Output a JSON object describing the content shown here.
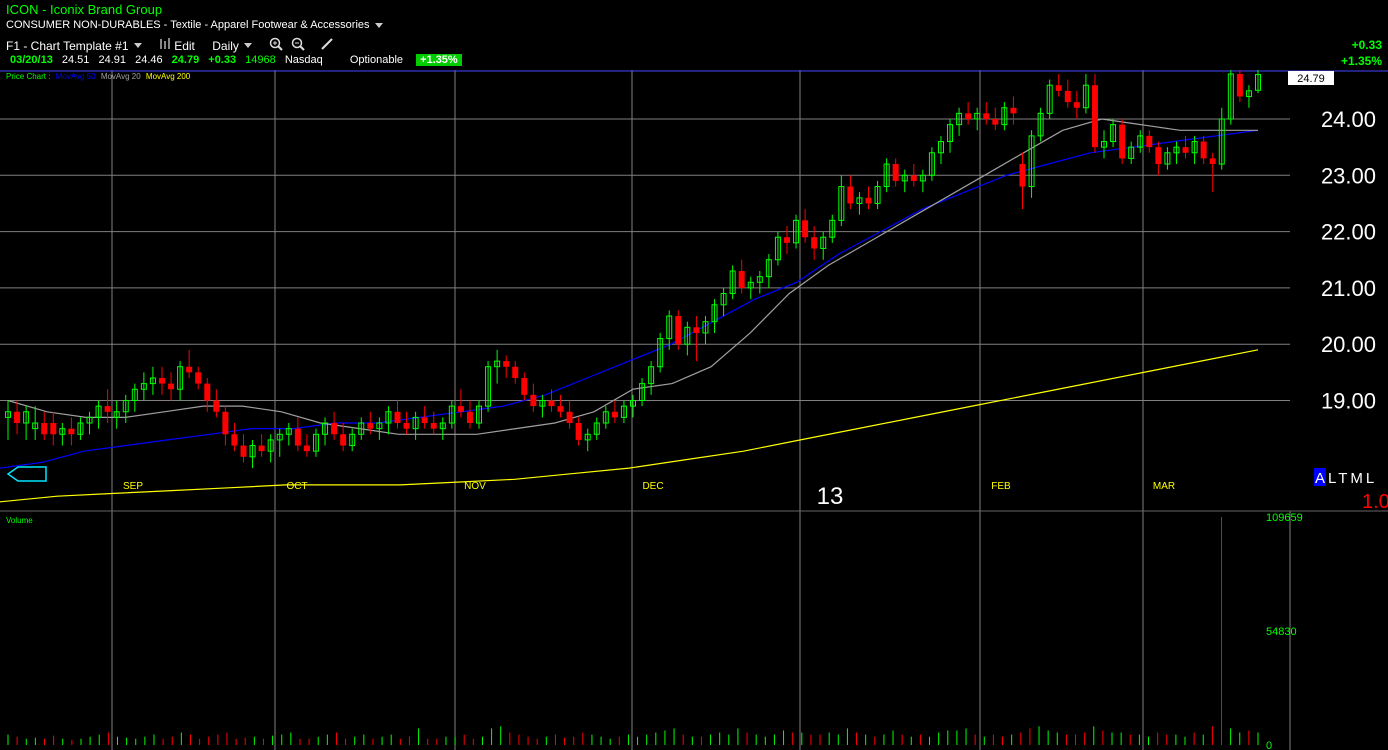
{
  "header": {
    "title": "ICON  -  Iconix Brand Group",
    "sector": "CONSUMER NON-DURABLES - Textile - Apparel Footwear & Accessories",
    "template": "F1 - Chart Template #1",
    "edit_label": "Edit",
    "period": "Daily"
  },
  "quote": {
    "date": "03/20/13",
    "open": "24.51",
    "high": "24.91",
    "low": "24.46",
    "last": "24.79",
    "change": "+0.33",
    "volume": "14968",
    "exchange": "Nasdaq",
    "optionable": "Optionable",
    "pct_change": "+1.35%"
  },
  "right_change": {
    "abs": "+0.33",
    "pct": "+1.35%"
  },
  "price_pane": {
    "legend": {
      "label": "Price Chart :",
      "ma50": "MovAvg 50",
      "ma20": "MovAvg 20",
      "ma200": "MovAvg 200"
    },
    "last_price_tag": "24.79",
    "y_ticks": [
      "24.00",
      "23.00",
      "22.00",
      "21.00",
      "20.00",
      "19.00"
    ],
    "months": [
      "SEP",
      "OCT",
      "NOV",
      "DEC",
      "FEB",
      "MAR"
    ],
    "year_marker": "13",
    "altml": {
      "a": "A",
      "rest": "LTML",
      "value": "1.0"
    }
  },
  "volume_pane": {
    "label": "Volume",
    "ticks": [
      "109659",
      "54830",
      "0"
    ]
  },
  "colors": {
    "up": "#00ff00",
    "down": "#ff0000",
    "ma50": "#0000ff",
    "ma20": "#a0a0a0",
    "ma200": "#ffff00",
    "grid": "#808080"
  },
  "chart_data": {
    "type": "candlestick",
    "symbol": "ICON",
    "x_period": "Daily",
    "y_ticks": [
      19,
      20,
      21,
      22,
      23,
      24
    ],
    "ohlc": [
      [
        18.7,
        19.0,
        18.3,
        18.8
      ],
      [
        18.8,
        19.0,
        18.4,
        18.6
      ],
      [
        18.6,
        18.9,
        18.3,
        18.8
      ],
      [
        18.5,
        18.9,
        18.3,
        18.6
      ],
      [
        18.6,
        18.8,
        18.3,
        18.4
      ],
      [
        18.6,
        18.8,
        18.2,
        18.4
      ],
      [
        18.4,
        18.6,
        18.2,
        18.5
      ],
      [
        18.5,
        18.7,
        18.2,
        18.4
      ],
      [
        18.4,
        18.7,
        18.3,
        18.6
      ],
      [
        18.6,
        18.8,
        18.4,
        18.7
      ],
      [
        18.7,
        19.0,
        18.5,
        18.9
      ],
      [
        18.9,
        19.2,
        18.6,
        18.8
      ],
      [
        18.7,
        19.0,
        18.5,
        18.8
      ],
      [
        18.8,
        19.1,
        18.6,
        19.0
      ],
      [
        19.0,
        19.3,
        18.8,
        19.2
      ],
      [
        19.2,
        19.5,
        19.0,
        19.3
      ],
      [
        19.3,
        19.6,
        19.1,
        19.4
      ],
      [
        19.4,
        19.6,
        19.1,
        19.3
      ],
      [
        19.3,
        19.5,
        19.0,
        19.2
      ],
      [
        19.2,
        19.7,
        19.0,
        19.6
      ],
      [
        19.6,
        19.9,
        19.4,
        19.5
      ],
      [
        19.5,
        19.6,
        19.2,
        19.3
      ],
      [
        19.3,
        19.4,
        18.8,
        19.0
      ],
      [
        19.0,
        19.2,
        18.7,
        18.8
      ],
      [
        18.8,
        18.9,
        18.2,
        18.4
      ],
      [
        18.4,
        18.6,
        18.1,
        18.2
      ],
      [
        18.2,
        18.4,
        17.9,
        18.0
      ],
      [
        18.0,
        18.3,
        17.8,
        18.2
      ],
      [
        18.2,
        18.4,
        18.0,
        18.1
      ],
      [
        18.1,
        18.4,
        17.9,
        18.3
      ],
      [
        18.3,
        18.5,
        18.0,
        18.4
      ],
      [
        18.4,
        18.6,
        18.2,
        18.5
      ],
      [
        18.5,
        18.7,
        18.1,
        18.2
      ],
      [
        18.2,
        18.4,
        18.0,
        18.1
      ],
      [
        18.1,
        18.5,
        18.0,
        18.4
      ],
      [
        18.4,
        18.7,
        18.2,
        18.6
      ],
      [
        18.6,
        18.8,
        18.3,
        18.4
      ],
      [
        18.4,
        18.6,
        18.1,
        18.2
      ],
      [
        18.2,
        18.5,
        18.1,
        18.4
      ],
      [
        18.4,
        18.7,
        18.3,
        18.6
      ],
      [
        18.6,
        18.8,
        18.4,
        18.5
      ],
      [
        18.5,
        18.7,
        18.3,
        18.6
      ],
      [
        18.6,
        18.9,
        18.4,
        18.8
      ],
      [
        18.8,
        19.0,
        18.5,
        18.6
      ],
      [
        18.6,
        18.8,
        18.4,
        18.5
      ],
      [
        18.5,
        18.8,
        18.3,
        18.7
      ],
      [
        18.7,
        18.9,
        18.5,
        18.6
      ],
      [
        18.6,
        18.8,
        18.4,
        18.5
      ],
      [
        18.5,
        18.7,
        18.3,
        18.6
      ],
      [
        18.6,
        19.0,
        18.5,
        18.9
      ],
      [
        18.9,
        19.2,
        18.7,
        18.8
      ],
      [
        18.8,
        19.0,
        18.5,
        18.6
      ],
      [
        18.6,
        19.0,
        18.5,
        18.9
      ],
      [
        18.9,
        19.7,
        18.8,
        19.6
      ],
      [
        19.6,
        19.9,
        19.3,
        19.7
      ],
      [
        19.7,
        19.8,
        19.4,
        19.6
      ],
      [
        19.6,
        19.7,
        19.3,
        19.4
      ],
      [
        19.4,
        19.5,
        19.0,
        19.1
      ],
      [
        19.1,
        19.3,
        18.8,
        18.9
      ],
      [
        18.9,
        19.1,
        18.7,
        19.0
      ],
      [
        19.0,
        19.2,
        18.8,
        18.9
      ],
      [
        18.9,
        19.1,
        18.7,
        18.8
      ],
      [
        18.8,
        19.0,
        18.5,
        18.6
      ],
      [
        18.6,
        18.7,
        18.2,
        18.3
      ],
      [
        18.3,
        18.5,
        18.1,
        18.4
      ],
      [
        18.4,
        18.7,
        18.3,
        18.6
      ],
      [
        18.6,
        18.9,
        18.5,
        18.8
      ],
      [
        18.8,
        19.0,
        18.6,
        18.7
      ],
      [
        18.7,
        19.0,
        18.6,
        18.9
      ],
      [
        18.9,
        19.1,
        18.7,
        19.0
      ],
      [
        19.0,
        19.4,
        18.9,
        19.3
      ],
      [
        19.3,
        19.7,
        19.1,
        19.6
      ],
      [
        19.6,
        20.2,
        19.5,
        20.1
      ],
      [
        20.1,
        20.6,
        19.9,
        20.5
      ],
      [
        20.5,
        20.6,
        19.9,
        20.0
      ],
      [
        20.0,
        20.4,
        19.8,
        20.3
      ],
      [
        20.3,
        20.5,
        19.7,
        20.2
      ],
      [
        20.2,
        20.5,
        20.0,
        20.4
      ],
      [
        20.4,
        20.8,
        20.2,
        20.7
      ],
      [
        20.7,
        21.0,
        20.5,
        20.9
      ],
      [
        20.9,
        21.4,
        20.8,
        21.3
      ],
      [
        21.3,
        21.5,
        20.9,
        21.0
      ],
      [
        21.0,
        21.2,
        20.8,
        21.1
      ],
      [
        21.1,
        21.3,
        20.9,
        21.2
      ],
      [
        21.2,
        21.6,
        21.0,
        21.5
      ],
      [
        21.5,
        22.0,
        21.4,
        21.9
      ],
      [
        21.9,
        22.1,
        21.6,
        21.8
      ],
      [
        21.8,
        22.3,
        21.7,
        22.2
      ],
      [
        22.2,
        22.4,
        21.8,
        21.9
      ],
      [
        21.9,
        22.1,
        21.5,
        21.7
      ],
      [
        21.7,
        22.0,
        21.5,
        21.9
      ],
      [
        21.9,
        22.3,
        21.8,
        22.2
      ],
      [
        22.2,
        23.0,
        22.1,
        22.8
      ],
      [
        22.8,
        23.0,
        22.4,
        22.5
      ],
      [
        22.5,
        22.7,
        22.3,
        22.6
      ],
      [
        22.6,
        22.8,
        22.4,
        22.5
      ],
      [
        22.5,
        22.9,
        22.4,
        22.8
      ],
      [
        22.8,
        23.3,
        22.7,
        23.2
      ],
      [
        23.2,
        23.3,
        22.8,
        22.9
      ],
      [
        22.9,
        23.1,
        22.7,
        23.0
      ],
      [
        23.0,
        23.2,
        22.8,
        22.9
      ],
      [
        22.9,
        23.1,
        22.7,
        23.0
      ],
      [
        23.0,
        23.5,
        22.9,
        23.4
      ],
      [
        23.4,
        23.7,
        23.2,
        23.6
      ],
      [
        23.6,
        24.0,
        23.4,
        23.9
      ],
      [
        23.9,
        24.2,
        23.7,
        24.1
      ],
      [
        24.1,
        24.3,
        23.9,
        24.0
      ],
      [
        24.0,
        24.2,
        23.8,
        24.1
      ],
      [
        24.1,
        24.3,
        23.9,
        24.0
      ],
      [
        24.0,
        24.2,
        23.8,
        23.9
      ],
      [
        23.9,
        24.3,
        23.8,
        24.2
      ],
      [
        24.2,
        24.4,
        23.9,
        24.1
      ],
      [
        23.2,
        23.4,
        22.4,
        22.8
      ],
      [
        22.8,
        23.8,
        22.6,
        23.7
      ],
      [
        23.7,
        24.2,
        23.6,
        24.1
      ],
      [
        24.1,
        24.7,
        24.0,
        24.6
      ],
      [
        24.6,
        24.8,
        24.4,
        24.5
      ],
      [
        24.5,
        24.7,
        24.2,
        24.3
      ],
      [
        24.3,
        24.5,
        24.0,
        24.2
      ],
      [
        24.2,
        24.8,
        24.1,
        24.6
      ],
      [
        24.6,
        24.8,
        23.4,
        23.5
      ],
      [
        23.5,
        23.8,
        23.3,
        23.6
      ],
      [
        23.6,
        24.0,
        23.5,
        23.9
      ],
      [
        23.9,
        24.0,
        23.2,
        23.3
      ],
      [
        23.3,
        23.6,
        23.2,
        23.5
      ],
      [
        23.5,
        23.8,
        23.4,
        23.7
      ],
      [
        23.7,
        23.8,
        23.4,
        23.5
      ],
      [
        23.5,
        23.6,
        23.0,
        23.2
      ],
      [
        23.2,
        23.5,
        23.1,
        23.4
      ],
      [
        23.4,
        23.6,
        23.2,
        23.5
      ],
      [
        23.5,
        23.7,
        23.3,
        23.4
      ],
      [
        23.4,
        23.7,
        23.2,
        23.6
      ],
      [
        23.6,
        23.7,
        23.2,
        23.3
      ],
      [
        23.3,
        23.4,
        22.7,
        23.2
      ],
      [
        23.2,
        24.2,
        23.1,
        24.0
      ],
      [
        24.0,
        24.9,
        23.9,
        24.8
      ],
      [
        24.8,
        24.9,
        24.3,
        24.4
      ],
      [
        24.4,
        24.6,
        24.2,
        24.5
      ],
      [
        24.51,
        24.91,
        24.46,
        24.79
      ]
    ],
    "ma20": [
      19.0,
      18.8,
      18.7,
      18.7,
      18.8,
      18.9,
      18.9,
      18.8,
      18.6,
      18.5,
      18.4,
      18.4,
      18.4,
      18.5,
      18.6,
      18.8,
      19.2,
      19.3,
      19.6,
      20.2,
      20.9,
      21.4,
      21.8,
      22.2,
      22.6,
      23.0,
      23.4,
      23.8,
      24.0,
      23.9,
      23.8,
      23.8,
      23.8
    ],
    "ma50": [
      17.8,
      17.9,
      18.1,
      18.2,
      18.3,
      18.4,
      18.5,
      18.5,
      18.6,
      18.6,
      18.7,
      18.8,
      18.9,
      19.1,
      19.4,
      19.7,
      20.0,
      20.4,
      20.8,
      21.1,
      21.6,
      22.0,
      22.4,
      22.7,
      23.0,
      23.2,
      23.4,
      23.5,
      23.6,
      23.7,
      23.8
    ],
    "ma200": [
      17.2,
      17.3,
      17.35,
      17.4,
      17.45,
      17.5,
      17.5,
      17.5,
      17.55,
      17.6,
      17.7,
      17.8,
      17.95,
      18.1,
      18.3,
      18.5,
      18.7,
      18.9,
      19.1,
      19.3,
      19.5,
      19.7,
      19.9
    ],
    "volume": [
      5000,
      4000,
      3000,
      3500,
      3000,
      4500,
      3000,
      2500,
      3000,
      4000,
      5000,
      6000,
      4000,
      3500,
      3000,
      4000,
      5000,
      3000,
      4000,
      6000,
      5000,
      3000,
      4000,
      5000,
      6000,
      3000,
      3500,
      4000,
      3000,
      4500,
      5000,
      6000,
      3000,
      3000,
      4000,
      5000,
      6000,
      3000,
      4000,
      5000,
      3000,
      4000,
      5000,
      3000,
      4000,
      8000,
      3000,
      3000,
      4000,
      4000,
      5000,
      3000,
      4000,
      8000,
      9000,
      6000,
      5000,
      4000,
      3000,
      4000,
      5000,
      3500,
      4000,
      6000,
      5000,
      4000,
      3000,
      4000,
      5000,
      4000,
      5000,
      6000,
      7000,
      8000,
      5000,
      4000,
      4000,
      5000,
      6000,
      5000,
      8000,
      6000,
      5000,
      4000,
      5000,
      7000,
      6000,
      6000,
      5000,
      5000,
      6000,
      5000,
      8000,
      6000,
      5000,
      4000,
      5000,
      7000,
      5000,
      4000,
      5000,
      4000,
      6000,
      7000,
      7000,
      8000,
      5000,
      4000,
      5000,
      4000,
      5000,
      6000,
      8000,
      9000,
      7000,
      6000,
      5000,
      5000,
      6000,
      9000,
      7000,
      6000,
      6000,
      5000,
      5000,
      4000,
      6000,
      5000,
      5000,
      4000,
      6000,
      5000,
      9000,
      109659,
      8000,
      6000,
      7000,
      6000
    ]
  }
}
